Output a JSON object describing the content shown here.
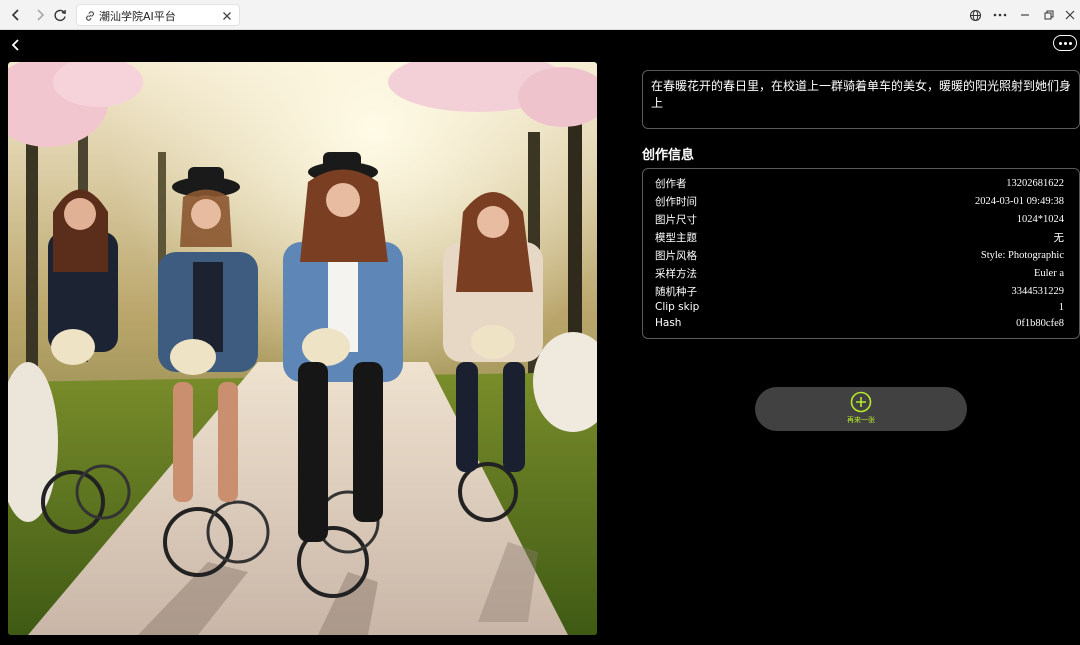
{
  "browser": {
    "tab_title": "潮汕学院AI平台"
  },
  "prompt": {
    "text": "在春暖花开的春日里，在校道上一群骑着单车的美女，暖暖的阳光照射到她们身上"
  },
  "info": {
    "title": "创作信息",
    "rows": [
      {
        "label": "创作者",
        "value": "13202681622"
      },
      {
        "label": "创作时间",
        "value": "2024-03-01 09:49:38"
      },
      {
        "label": "图片尺寸",
        "value": "1024*1024"
      },
      {
        "label": "模型主题",
        "value": "无"
      },
      {
        "label": "图片风格",
        "value": "Style: Photographic"
      },
      {
        "label": "采样方法",
        "value": "Euler a"
      },
      {
        "label": "随机种子",
        "value": "3344531229"
      },
      {
        "label": "Clip skip",
        "value": "1"
      },
      {
        "label": "Hash",
        "value": "0f1b80cfe8"
      }
    ]
  },
  "actions": {
    "again_label": "再来一张"
  },
  "colors": {
    "accent": "#b7ea2c",
    "background": "#000000",
    "button_bg": "#414141"
  }
}
